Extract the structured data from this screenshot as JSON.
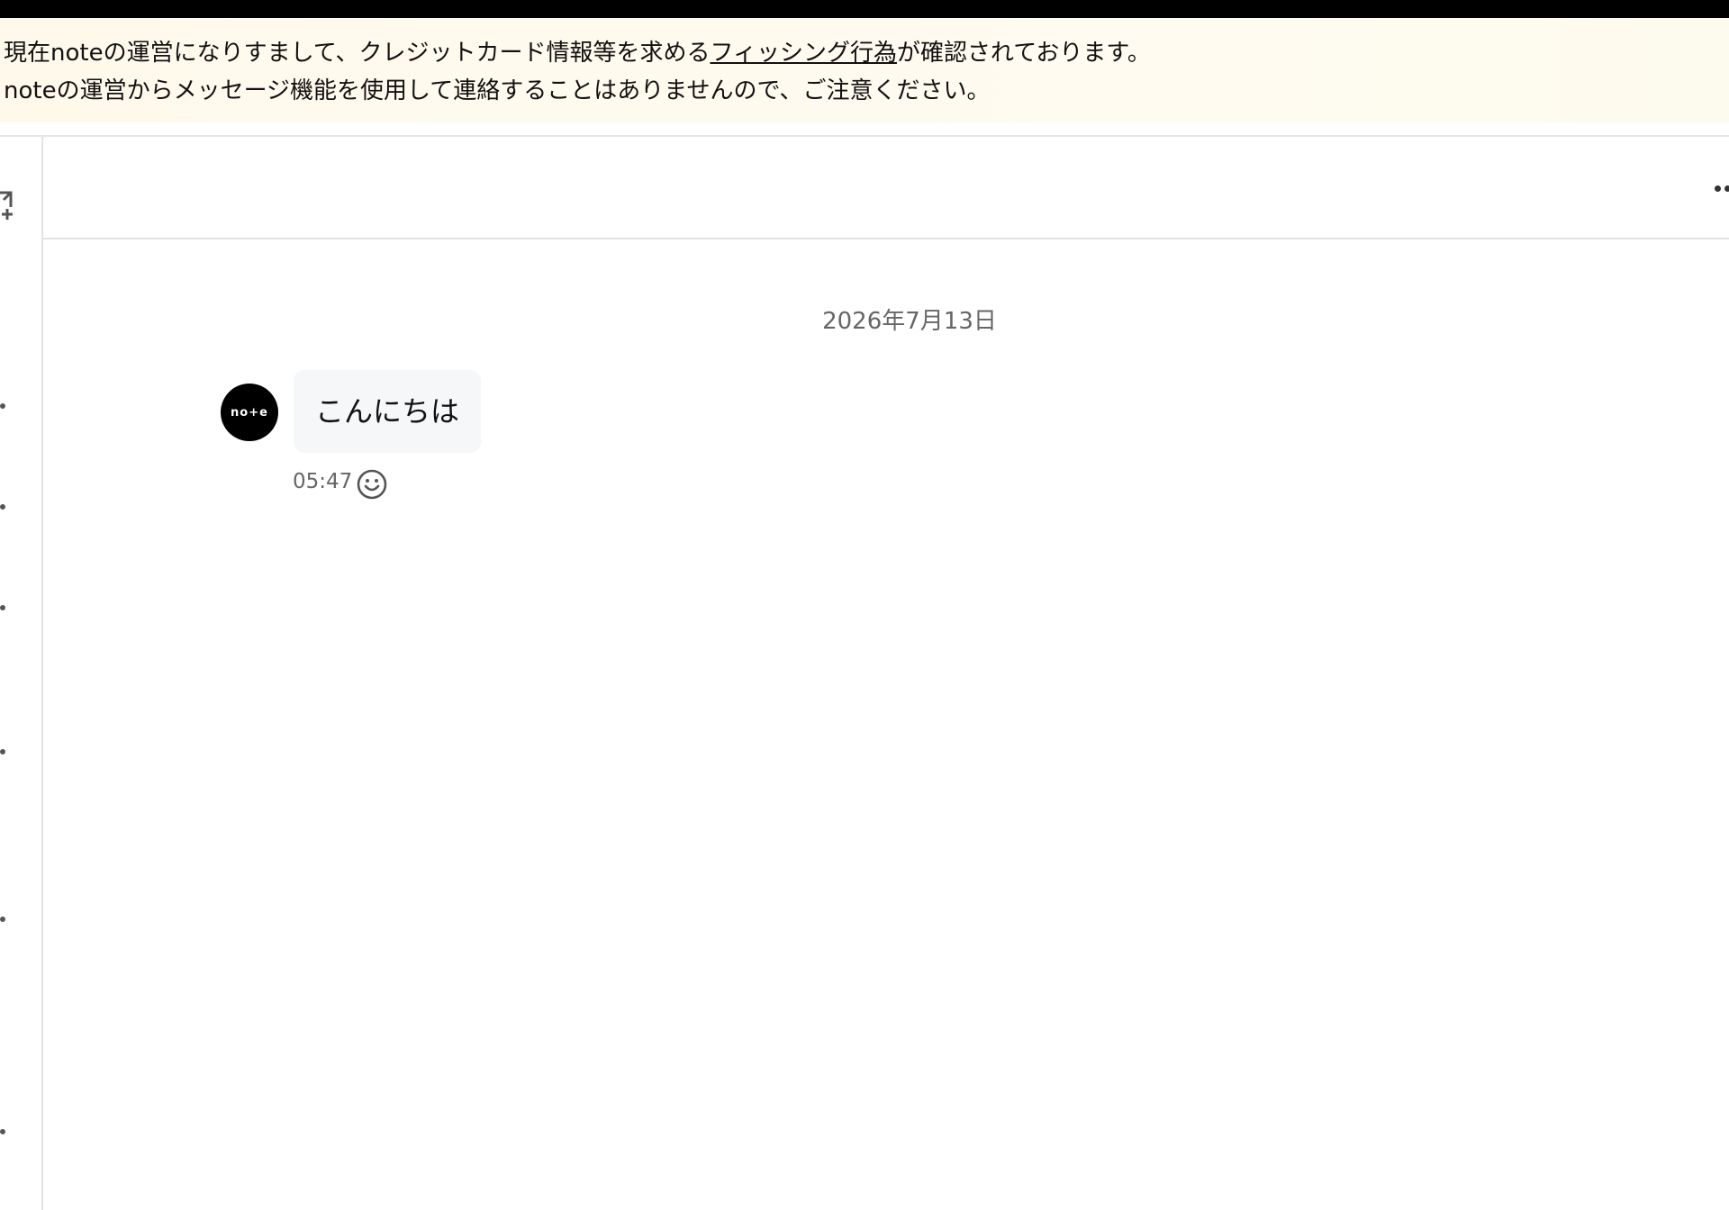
{
  "notice": {
    "line1_before": "現在noteの運営になりすまして、クレジットカード情報等を求める",
    "line1_link": "フィッシング行為",
    "line1_after": "が確認されております。",
    "line2": "noteの運営からメッセージ機能を使用して連絡することはありませんので、ご注意ください。"
  },
  "sidebar": {
    "icons": [
      "compose-icon"
    ]
  },
  "header": {
    "menu_icon": "more-dots-icon"
  },
  "conversation": {
    "date": "2026年7月13日",
    "messages": [
      {
        "avatar_text": "no+e",
        "text": "こんにちは",
        "time": "05:47",
        "reaction_icon": "smiley-icon"
      }
    ]
  },
  "colors": {
    "notice_bg": "#fff9ec",
    "avatar_bg": "#000000",
    "bubble_bg": "#f6f7f8",
    "muted_text": "#666666"
  }
}
